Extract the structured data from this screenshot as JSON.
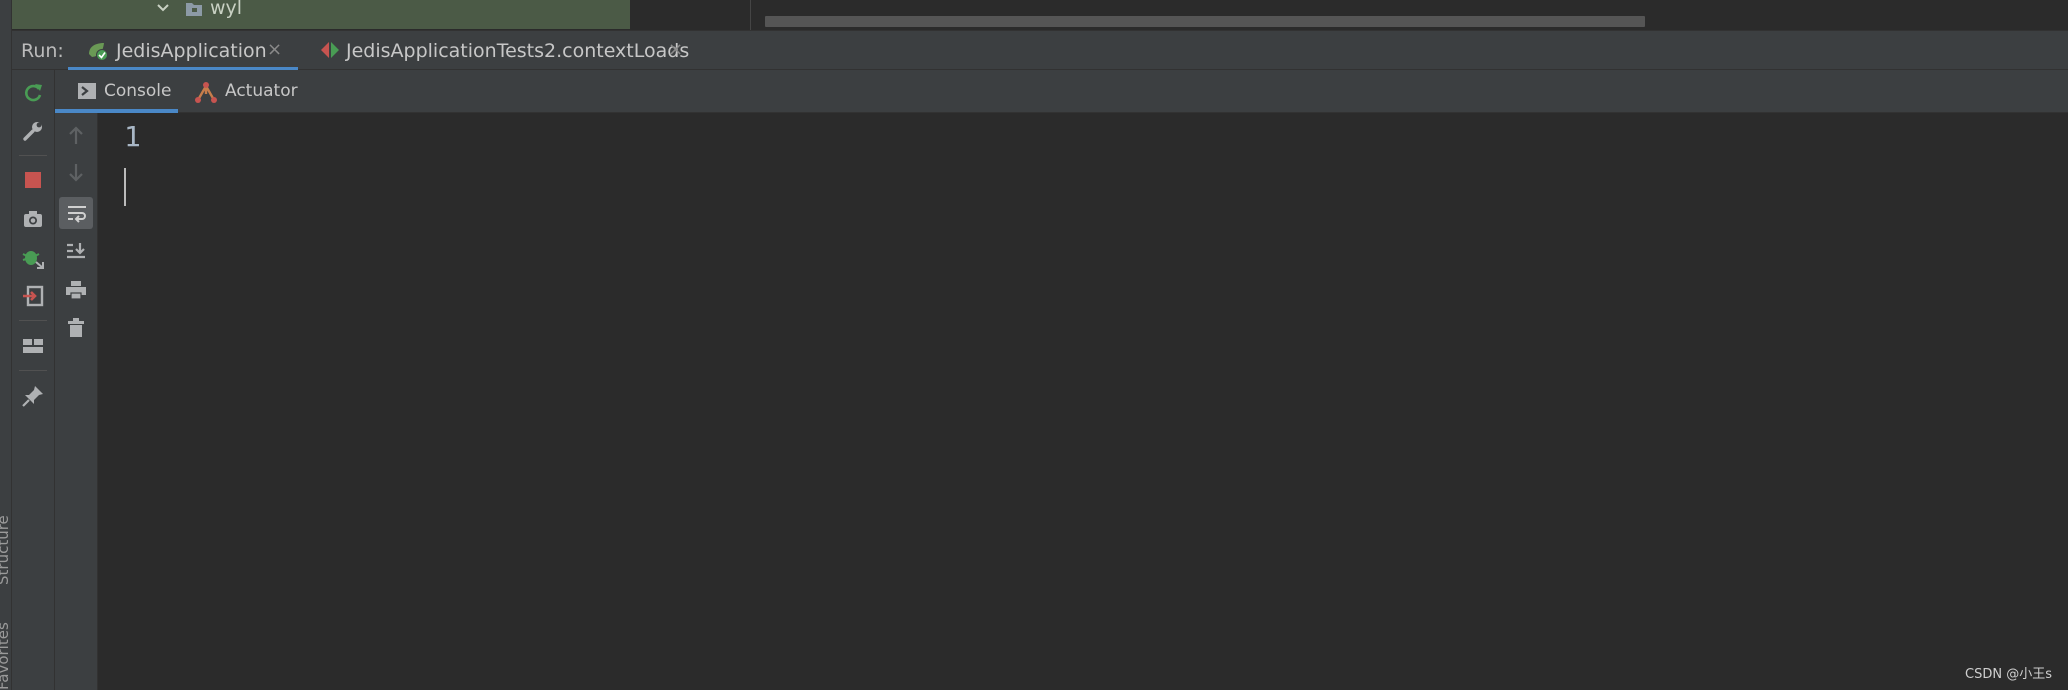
{
  "project_tree": {
    "folder_label": "wyl"
  },
  "run_bar": {
    "label": "Run:",
    "tabs": [
      {
        "label": "JedisApplication",
        "active": true
      },
      {
        "label": "JedisApplicationTests2.contextLoads",
        "active": false
      }
    ],
    "close_glyph": "×"
  },
  "console_tabs": [
    {
      "label": "Console",
      "active": true
    },
    {
      "label": "Actuator",
      "active": false
    }
  ],
  "side_toolbar_icons": [
    "rerun-icon",
    "wrench-icon",
    "stop-icon",
    "camera-icon",
    "debug-icon",
    "exit-icon",
    "layout-icon",
    "pin-icon"
  ],
  "console_toolbar_icons": [
    "up-arrow-icon",
    "down-arrow-icon",
    "soft-wrap-icon",
    "scroll-to-end-icon",
    "print-icon",
    "trash-icon"
  ],
  "console": {
    "output_lines": [
      "1"
    ]
  },
  "tool_windows": {
    "structure": "Structure",
    "favorites": "Favorites"
  },
  "watermark": "CSDN @小王s",
  "colors": {
    "accent": "#4a88c7",
    "project_panel": "#4b5a46",
    "background": "#2b2b2b",
    "toolbar": "#3c3f41",
    "stop_red": "#c75450",
    "run_green": "#499c54"
  }
}
